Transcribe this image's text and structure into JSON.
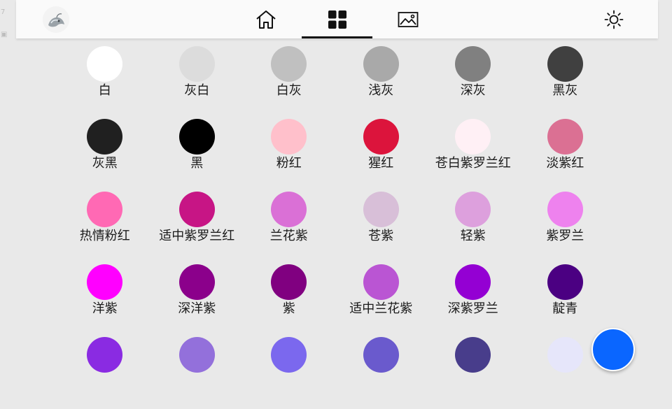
{
  "edge_marks": [
    "7",
    "▣"
  ],
  "nav": {
    "tabs": [
      {
        "name": "home",
        "icon": "home-icon"
      },
      {
        "name": "palette",
        "icon": "grid-icon",
        "active": true
      },
      {
        "name": "gallery",
        "icon": "image-icon"
      }
    ],
    "theme_icon": "sun-icon"
  },
  "colors": [
    {
      "label": "白",
      "hex": "#ffffff"
    },
    {
      "label": "灰白",
      "hex": "#dcdcdc"
    },
    {
      "label": "白灰",
      "hex": "#c0c0c0"
    },
    {
      "label": "浅灰",
      "hex": "#a9a9a9"
    },
    {
      "label": "深灰",
      "hex": "#808080"
    },
    {
      "label": "黑灰",
      "hex": "#404040"
    },
    {
      "label": "灰黑",
      "hex": "#202020"
    },
    {
      "label": "黑",
      "hex": "#000000"
    },
    {
      "label": "粉红",
      "hex": "#ffc0cb"
    },
    {
      "label": "猩红",
      "hex": "#dc143c"
    },
    {
      "label": "苍白紫罗兰红",
      "hex": "#fff0f5"
    },
    {
      "label": "淡紫红",
      "hex": "#db7093"
    },
    {
      "label": "热情粉红",
      "hex": "#ff69b4"
    },
    {
      "label": "适中紫罗兰红",
      "hex": "#c71585"
    },
    {
      "label": "兰花紫",
      "hex": "#da70d6"
    },
    {
      "label": "苍紫",
      "hex": "#d8bfd8"
    },
    {
      "label": "轻紫",
      "hex": "#dda0dd"
    },
    {
      "label": "紫罗兰",
      "hex": "#ee82ee"
    },
    {
      "label": "洋紫",
      "hex": "#ff00ff"
    },
    {
      "label": "深洋紫",
      "hex": "#8b008b"
    },
    {
      "label": "紫",
      "hex": "#800080"
    },
    {
      "label": "适中兰花紫",
      "hex": "#ba55d3"
    },
    {
      "label": "深紫罗兰",
      "hex": "#9400d3"
    },
    {
      "label": "靛青",
      "hex": "#4b0082"
    },
    {
      "label": "",
      "hex": "#8a2be2"
    },
    {
      "label": "",
      "hex": "#9370db"
    },
    {
      "label": "",
      "hex": "#7b68ee"
    },
    {
      "label": "",
      "hex": "#6a5acd"
    },
    {
      "label": "",
      "hex": "#483d8b"
    },
    {
      "label": "",
      "hex": "#e6e6fa"
    }
  ],
  "fab": {
    "color": "#0a66ff",
    "icon": "add-color-button"
  }
}
